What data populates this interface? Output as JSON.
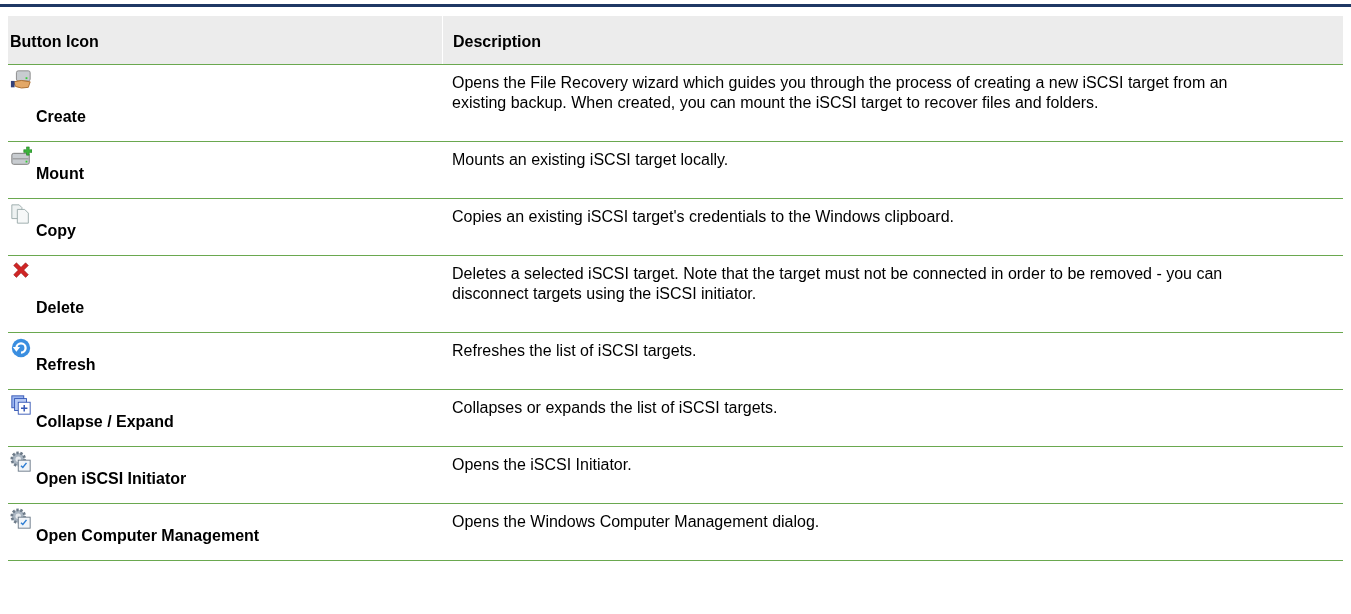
{
  "table": {
    "columns": [
      "Button Icon",
      "Description"
    ],
    "rows": [
      {
        "kind": "create",
        "name": "Create",
        "description": "Opens the File Recovery wizard which guides you through the process of creating a new iSCSI target from an existing backup. When created, you can mount the iSCSI target to recover files and folders."
      },
      {
        "kind": "mount",
        "name": "Mount",
        "description": "Mounts an existing iSCSI target locally."
      },
      {
        "kind": "copy",
        "name": "Copy",
        "description": "Copies an existing iSCSI target's credentials to the Windows clipboard."
      },
      {
        "kind": "delete",
        "name": "Delete",
        "description": "Deletes a selected iSCSI target. Note that the target must not be connected in order to be removed - you can disconnect targets using the iSCSI initiator."
      },
      {
        "kind": "refresh",
        "name": "Refresh",
        "description": "Refreshes the list of iSCSI targets."
      },
      {
        "kind": "collapse",
        "name": "Collapse / Expand",
        "description": "Collapses or expands the list of iSCSI targets."
      },
      {
        "kind": "gear",
        "name": "Open iSCSI Initiator",
        "description": "Opens the iSCSI Initiator."
      },
      {
        "kind": "gear",
        "name": "Open Computer Management",
        "description": "Opens the Windows Computer Management dialog."
      }
    ]
  }
}
